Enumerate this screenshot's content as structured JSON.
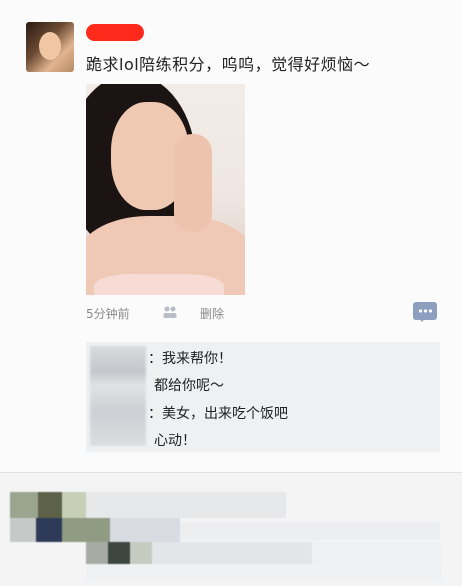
{
  "post": {
    "text": "跪求lol陪练积分，呜呜，觉得好烦恼～",
    "time": "5分钟前",
    "delete_label": "删除"
  },
  "comments": [
    {
      "text": "：我来帮你！"
    },
    {
      "text": "都给你呢～"
    },
    {
      "text": "：美女，出来吃个饭吧"
    },
    {
      "text": "心动！"
    }
  ],
  "colors": {
    "redaction": "#ff2a1b",
    "accent": "#8c9fbe"
  },
  "icons": {
    "like": "like-icon",
    "comment": "comment-icon"
  }
}
